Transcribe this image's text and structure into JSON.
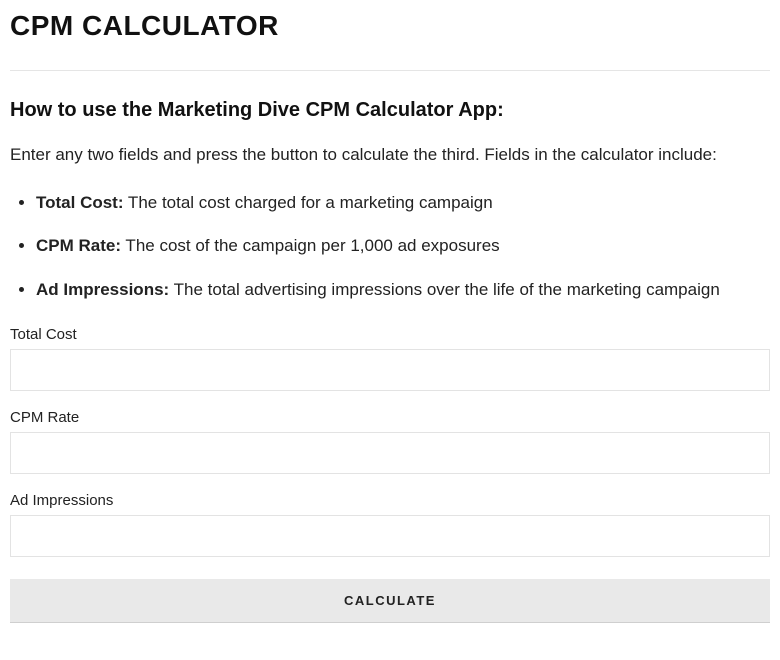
{
  "page_title": "CPM CALCULATOR",
  "how_to_heading": "How to use the Marketing Dive CPM Calculator App:",
  "intro_text": "Enter any two fields and press the button to calculate the third.  Fields in the calculator include:",
  "definitions": [
    {
      "term": "Total Cost:",
      "desc": " The total cost charged for a marketing campaign"
    },
    {
      "term": "CPM Rate:",
      "desc": " The cost of the campaign per 1,000 ad exposures"
    },
    {
      "term": "Ad Impressions:",
      "desc": " The total advertising impressions over the life of the marketing campaign"
    }
  ],
  "fields": {
    "total_cost": {
      "label": "Total Cost",
      "value": ""
    },
    "cpm_rate": {
      "label": "CPM Rate",
      "value": ""
    },
    "ad_impressions": {
      "label": "Ad Impressions",
      "value": ""
    }
  },
  "button_label": "CALCULATE"
}
